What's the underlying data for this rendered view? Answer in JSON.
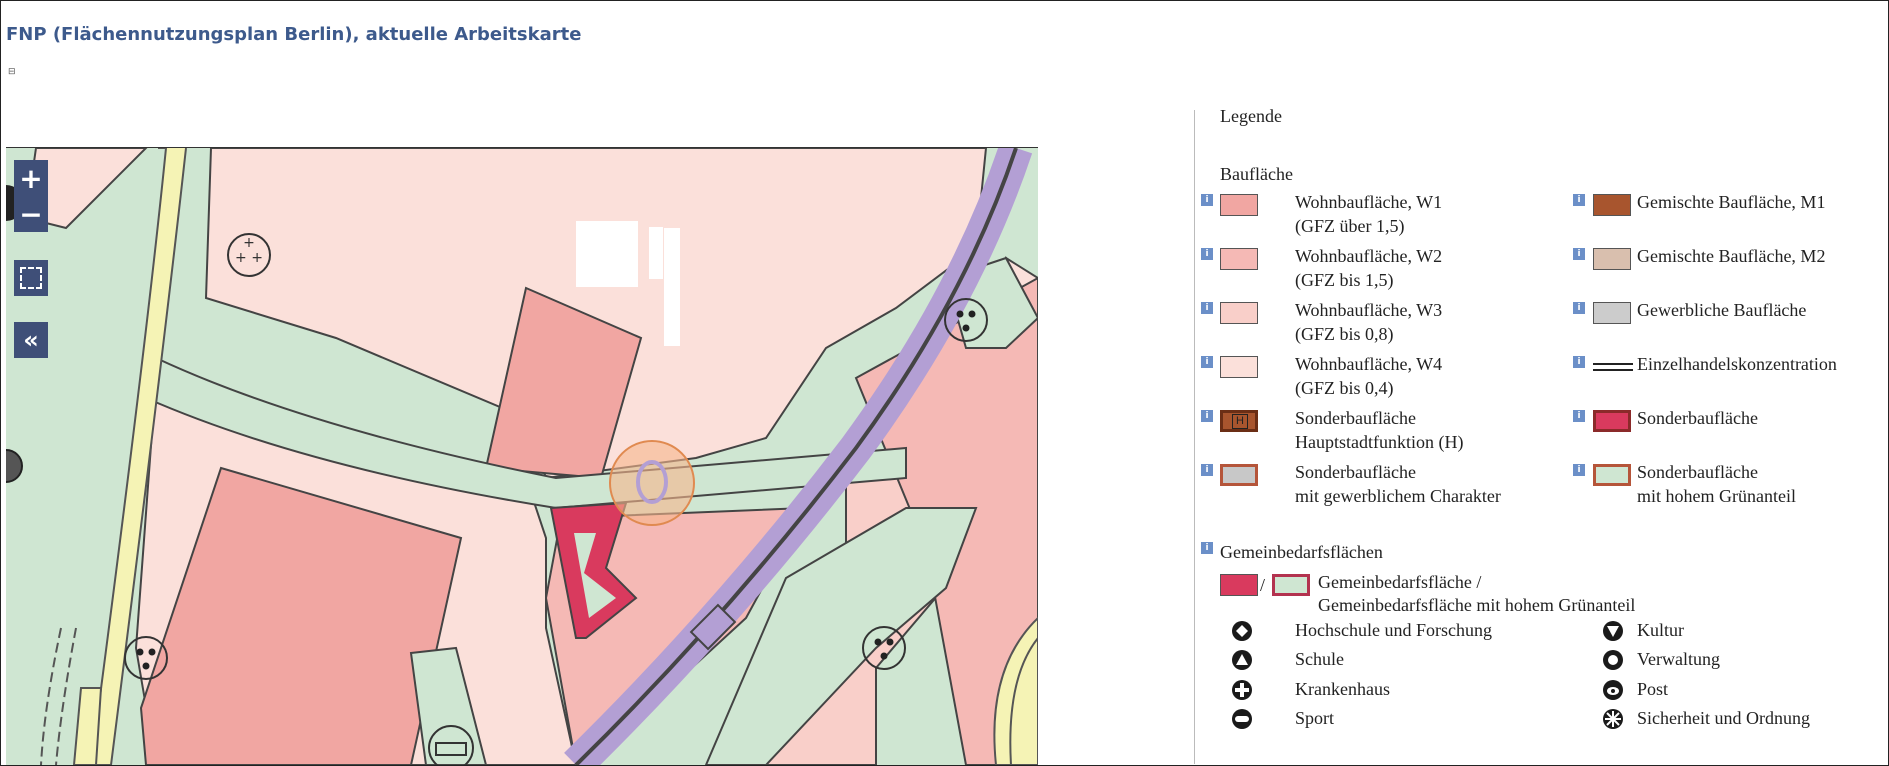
{
  "page": {
    "title": "FNP (Flächennutzungsplan Berlin), aktuelle Arbeitskarte",
    "small_icon": "⊟"
  },
  "map_controls": {
    "zoom_in": "+",
    "zoom_out": "−",
    "fullscreen": "⛶",
    "collapse": "«"
  },
  "legend": {
    "title": "Legende",
    "bauflaeche": {
      "heading": "Baufläche",
      "left": [
        {
          "l1": "Wohnbaufläche, W1",
          "l2": "(GFZ über 1,5)",
          "color": "#f1a6a2"
        },
        {
          "l1": "Wohnbaufläche, W2",
          "l2": "(GFZ bis 1,5)",
          "color": "#f5b9b5"
        },
        {
          "l1": "Wohnbaufläche, W3",
          "l2": "(GFZ bis 0,8)",
          "color": "#f9cfc9"
        },
        {
          "l1": "Wohnbaufläche, W4",
          "l2": "(GFZ bis 0,4)",
          "color": "#fbe0da"
        },
        {
          "l1": "Sonderbaufläche",
          "l2": "Hauptstadtfunktion (H)",
          "color": "#a8552e",
          "mark": "H"
        },
        {
          "l1": "Sonderbaufläche",
          "l2": "mit gewerblichem Charakter",
          "color": "#c8c8c8",
          "border": "#b5553a"
        }
      ],
      "right": [
        {
          "l1": "Gemischte Baufläche, M1",
          "color": "#a8552e"
        },
        {
          "l1": "Gemischte Baufläche, M2",
          "color": "#d9bfae"
        },
        {
          "l1": "Gewerbliche Baufläche",
          "color": "#cccccc"
        },
        {
          "l1": "Einzelhandelskonzentration",
          "symbol": "double-line"
        },
        {
          "l1": "Sonderbaufläche",
          "color": "#d93a5e",
          "border": "#8b2a2a"
        },
        {
          "l1": "Sonderbaufläche",
          "l2": "mit hohem Grünanteil",
          "color": "#cfe6d2",
          "border": "#b5553a"
        }
      ]
    },
    "gemeinbedarf": {
      "heading": "Gemeinbedarfsflächen",
      "swatch_a": "#d93a5e",
      "swatch_b": "#cfe6d2",
      "swatch_b_border": "#b3324f",
      "separator": "/",
      "l1": "Gemeinbedarfsfläche /",
      "l2": "Gemeinbedarfsfläche mit hohem Grünanteil",
      "left": [
        {
          "icon": "hochschule-icon",
          "label": "Hochschule und Forschung"
        },
        {
          "icon": "schule-icon",
          "label": "Schule"
        },
        {
          "icon": "krankenhaus-icon",
          "label": "Krankenhaus"
        },
        {
          "icon": "sport-icon",
          "label": "Sport"
        }
      ],
      "right": [
        {
          "icon": "kultur-icon",
          "label": "Kultur"
        },
        {
          "icon": "verwaltung-icon",
          "label": "Verwaltung"
        },
        {
          "icon": "post-icon",
          "label": "Post"
        },
        {
          "icon": "sicherheit-icon",
          "label": "Sicherheit und Ordnung"
        }
      ]
    },
    "info_glyph": "i"
  }
}
